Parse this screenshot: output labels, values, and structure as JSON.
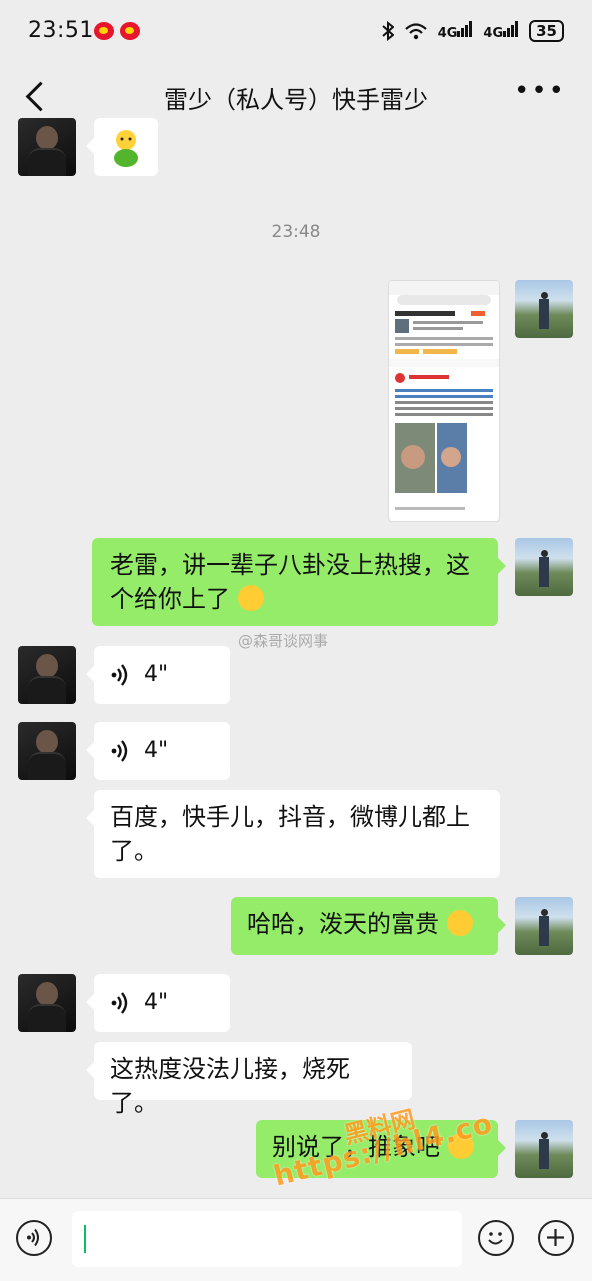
{
  "status_bar": {
    "time": "23:51",
    "signal_1": "4G",
    "signal_2": "4G",
    "battery": "35"
  },
  "header": {
    "title": "雷少（私人号）快手雷少"
  },
  "chat": {
    "timestamp": "23:48",
    "messages": [
      {
        "from": "them",
        "type": "sticker",
        "icon": "green-figure-sticker"
      },
      {
        "from": "me",
        "type": "image",
        "caption": "screenshot-of-trending-post"
      },
      {
        "from": "me",
        "type": "text",
        "text": "老雷，讲一辈子八卦没上热搜，这个给你上了"
      },
      {
        "from": "them",
        "type": "voice",
        "duration": "4\""
      },
      {
        "from": "them",
        "type": "voice",
        "duration": "4\""
      },
      {
        "from": "them",
        "type": "text",
        "text": "百度，快手儿，抖音，微博儿都上了。"
      },
      {
        "from": "me",
        "type": "text",
        "text": "哈哈，泼天的富贵"
      },
      {
        "from": "them",
        "type": "voice",
        "duration": "4\""
      },
      {
        "from": "them",
        "type": "text",
        "text": "这热度没法儿接，烧死了。"
      },
      {
        "from": "me",
        "type": "text",
        "text": "别说了，推象吧"
      }
    ]
  },
  "watermarks": {
    "weibo": "@森哥谈网事",
    "site_top": "黑料网",
    "site_url": "https://hl4.co"
  },
  "colors": {
    "my_bubble": "#95ec69",
    "their_bubble": "#ffffff",
    "background": "#ededed",
    "watermark": "#ff9a1f"
  }
}
